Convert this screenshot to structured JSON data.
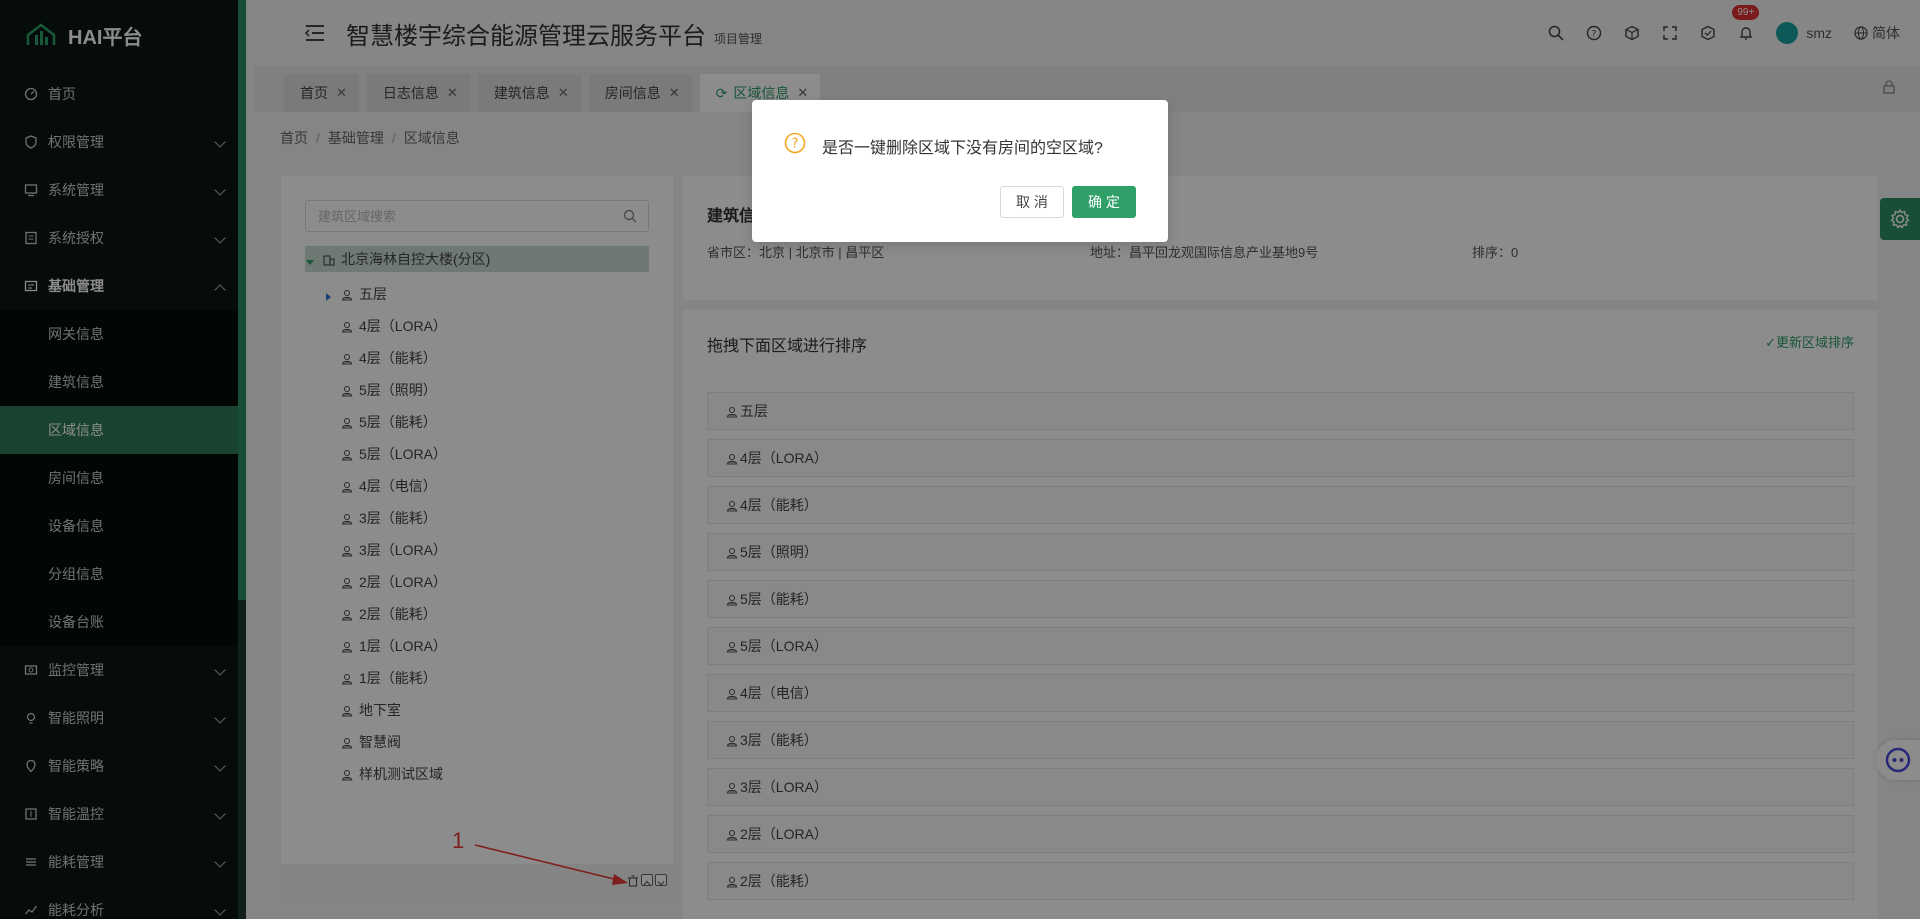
{
  "app": {
    "logo_text": "HAI平台"
  },
  "sidebar": {
    "items": [
      {
        "label": "首页",
        "icon": "dashboard-icon"
      },
      {
        "label": "权限管理",
        "icon": "shield-icon"
      },
      {
        "label": "系统管理",
        "icon": "monitor-icon"
      },
      {
        "label": "系统授权",
        "icon": "license-icon"
      },
      {
        "label": "基础管理",
        "icon": "database-icon"
      },
      {
        "label": "监控管理",
        "icon": "camera-icon"
      },
      {
        "label": "智能照明",
        "icon": "bulb-icon"
      },
      {
        "label": "智能策略",
        "icon": "strategy-icon"
      },
      {
        "label": "智能温控",
        "icon": "thermostat-icon"
      },
      {
        "label": "能耗管理",
        "icon": "energy-icon"
      },
      {
        "label": "能耗分析",
        "icon": "analysis-icon"
      }
    ],
    "sub_items": [
      "网关信息",
      "建筑信息",
      "区域信息",
      "房间信息",
      "设备信息",
      "分组信息",
      "设备台账"
    ]
  },
  "header": {
    "title": "智慧楼宇综合能源管理云服务平台",
    "subtitle": "项目管理",
    "badge": "99+",
    "user": "smz",
    "lang": "简体"
  },
  "tabs": [
    {
      "label": "首页"
    },
    {
      "label": "日志信息"
    },
    {
      "label": "建筑信息"
    },
    {
      "label": "房间信息"
    },
    {
      "label": "区域信息"
    }
  ],
  "breadcrumb": [
    "首页",
    "基础管理",
    "区域信息"
  ],
  "tree": {
    "search_placeholder": "建筑区域搜索",
    "root": "北京海林自控大楼(分区)",
    "children": [
      "五层",
      "4层（LORA）",
      "4层（能耗）",
      "5层（照明）",
      "5层（能耗）",
      "5层（LORA）",
      "4层（电信）",
      "3层（能耗）",
      "3层（LORA）",
      "2层（LORA）",
      "2层（能耗）",
      "1层（LORA）",
      "1层（能耗）",
      "地下室",
      "智慧阀",
      "样机测试区域"
    ]
  },
  "info": {
    "title": "建筑信",
    "province": "省市区：北京 | 北京市 | 昌平区",
    "address": "地址：昌平回龙观国际信息产业基地9号",
    "order": "排序：0"
  },
  "sort": {
    "title": "拖拽下面区域进行排序",
    "update": "✓更新区域排序",
    "items": [
      "五层",
      "4层（LORA）",
      "4层（能耗）",
      "5层（照明）",
      "5层（能耗）",
      "5层（LORA）",
      "4层（电信）",
      "3层（能耗）",
      "3层（LORA）",
      "2层（LORA）",
      "2层（能耗）"
    ]
  },
  "annotation": {
    "number": "1"
  },
  "dialog": {
    "message": "是否一键删除区域下没有房间的空区域?",
    "cancel": "取 消",
    "ok": "确 定"
  },
  "colors": {
    "accent": "#2f9b6a",
    "sidebar_bg": "#0b1714",
    "active_menu": "#2f7a55"
  }
}
